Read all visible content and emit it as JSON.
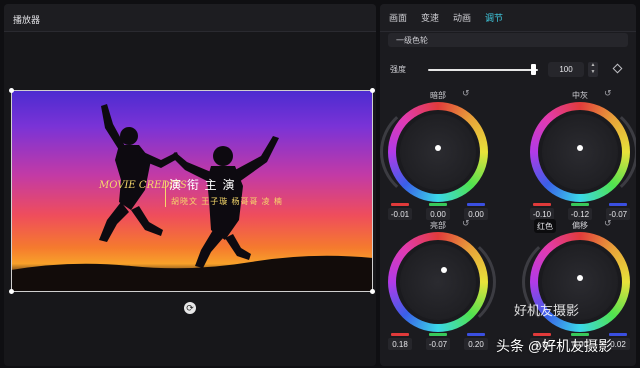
{
  "player": {
    "title": "播放器"
  },
  "credits": {
    "title": "MOVIE CREDITS",
    "heading": "演 衔 主 演",
    "names": "胡晓文 王子璇 杨哥哥 凌 楠"
  },
  "tabs": [
    {
      "label": "画面"
    },
    {
      "label": "变速"
    },
    {
      "label": "动画"
    },
    {
      "label": "调节",
      "active": true
    }
  ],
  "preset": {
    "value": "一级色轮"
  },
  "strength": {
    "label": "强度",
    "value": "100",
    "fill_fraction": 0.96
  },
  "wheels": [
    {
      "title": "暗部",
      "values": [
        "-0.01",
        "0.00",
        "0.00"
      ]
    },
    {
      "title": "中灰",
      "values": [
        "-0.10",
        "-0.12",
        "-0.07"
      ]
    },
    {
      "title": "亮部",
      "values": [
        "0.18",
        "-0.07",
        "0.20"
      ]
    },
    {
      "title": "偏移",
      "values": [
        "-0.01",
        "0.00",
        "0.02"
      ]
    }
  ],
  "tooltip": {
    "text": "红色"
  },
  "watermark": {
    "text": "头条 @好机友摄影",
    "overlay": "好机友摄影"
  },
  "colors": {
    "accent": "#41d0e6",
    "red": "#e03a3a",
    "green": "#38c95a",
    "blue": "#3a4fe0"
  },
  "icons": {
    "reset": "reset-icon",
    "rotate": "rotate-icon",
    "keyframe": "diamond-icon"
  }
}
